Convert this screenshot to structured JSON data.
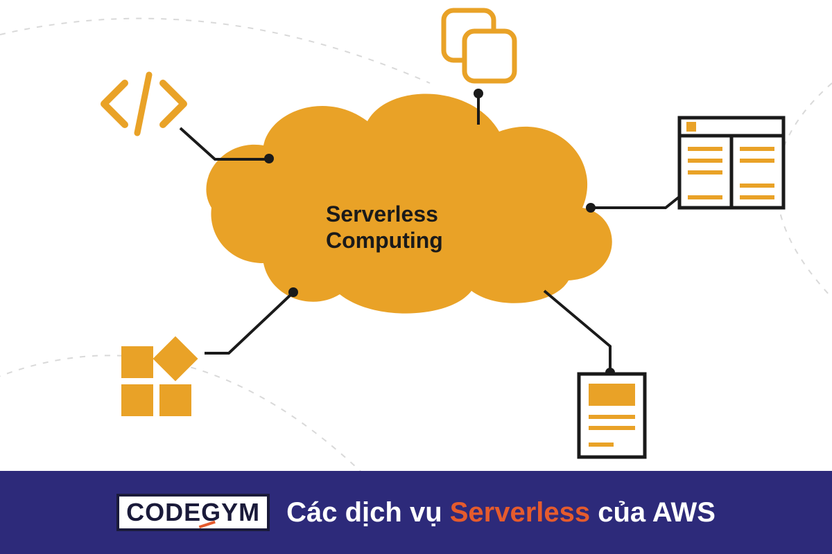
{
  "diagram": {
    "center_label_line1": "Serverless",
    "center_label_line2": "Computing",
    "nodes": {
      "code": "code-icon",
      "windows": "stacked-windows-icon",
      "layout": "layout-panel-icon",
      "blocks": "blocks-grid-icon",
      "document": "document-icon"
    }
  },
  "footer": {
    "logo": "CODEGYM",
    "title_before": "Các dịch vụ ",
    "title_highlight": "Serverless",
    "title_after": " của AWS"
  },
  "colors": {
    "orange": "#e9a227",
    "orange_fill": "#e9a227",
    "dark": "#1a1a1a",
    "footer_bg": "#2d2a7a",
    "accent": "#e55b2d"
  }
}
